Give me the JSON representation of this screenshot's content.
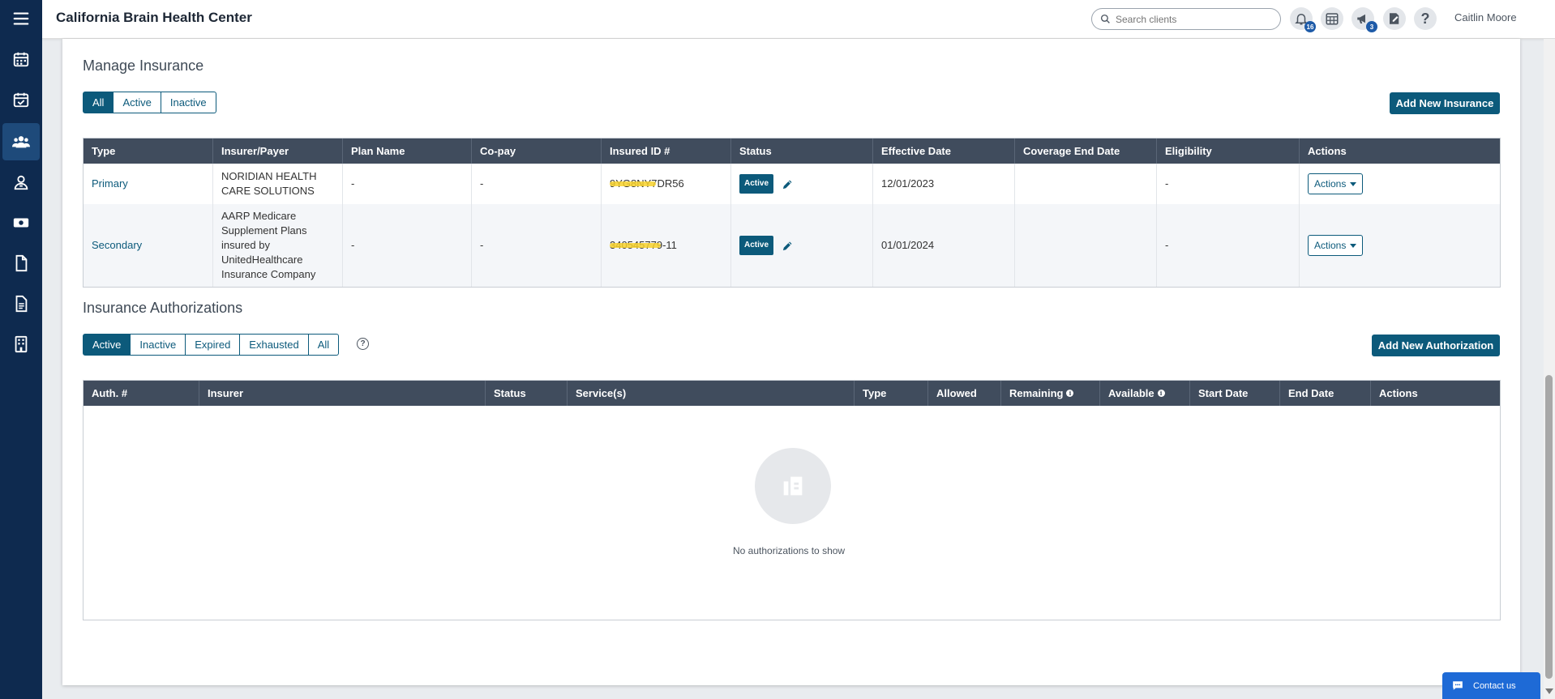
{
  "app": {
    "title": "California Brain Health Center"
  },
  "sidebar": {
    "items": [
      {
        "icon": "menu-icon"
      },
      {
        "icon": "calendar-icon"
      },
      {
        "icon": "calendar-check-icon"
      },
      {
        "icon": "clients-icon",
        "active": true
      },
      {
        "icon": "staff-icon"
      },
      {
        "icon": "billing-icon"
      },
      {
        "icon": "document-icon"
      },
      {
        "icon": "report-icon"
      },
      {
        "icon": "building-icon"
      }
    ]
  },
  "topbar": {
    "search_placeholder": "Search clients",
    "notifications_count": "16",
    "announcements_count": "3",
    "help_label": "?",
    "user_name": "Caitlin Moore"
  },
  "insurance": {
    "title": "Manage Insurance",
    "filters": [
      "All",
      "Active",
      "Inactive"
    ],
    "active_filter": "All",
    "add_button": "Add New Insurance",
    "columns": [
      "Type",
      "Insurer/Payer",
      "Plan Name",
      "Co-pay",
      "Insured ID #",
      "Status",
      "Effective Date",
      "Coverage End Date",
      "Eligibility",
      "Actions"
    ],
    "rows": [
      {
        "type": "Primary",
        "insurer": "NORIDIAN HEALTH CARE SOLUTIONS",
        "plan_name": "-",
        "copay": "-",
        "insured_id": "9YG8NY7DR56",
        "status": "Active",
        "effective_date": "12/01/2023",
        "coverage_end_date": "",
        "eligibility": "-",
        "actions": "Actions"
      },
      {
        "type": "Secondary",
        "insurer": "AARP Medicare Supplement Plans insured by UnitedHealthcare Insurance Company",
        "plan_name": "-",
        "copay": "-",
        "insured_id": "340545779-11",
        "status": "Active",
        "effective_date": "01/01/2024",
        "coverage_end_date": "",
        "eligibility": "-",
        "actions": "Actions"
      }
    ]
  },
  "authorizations": {
    "title": "Insurance Authorizations",
    "filters": [
      "Active",
      "Inactive",
      "Expired",
      "Exhausted",
      "All"
    ],
    "active_filter": "Active",
    "help_label": "?",
    "add_button": "Add New Authorization",
    "columns": [
      "Auth. #",
      "Insurer",
      "Status",
      "Service(s)",
      "Type",
      "Allowed",
      "Remaining",
      "Available",
      "Start Date",
      "End Date",
      "Actions"
    ],
    "info_columns": [
      "Remaining",
      "Available"
    ],
    "empty_message": "No authorizations to show"
  },
  "contact": {
    "label": "Contact us"
  },
  "colors": {
    "sidebar": "#0e2a4f",
    "accent": "#0c5a7b",
    "table_header": "#404c5d",
    "contact": "#1e6ad6"
  }
}
